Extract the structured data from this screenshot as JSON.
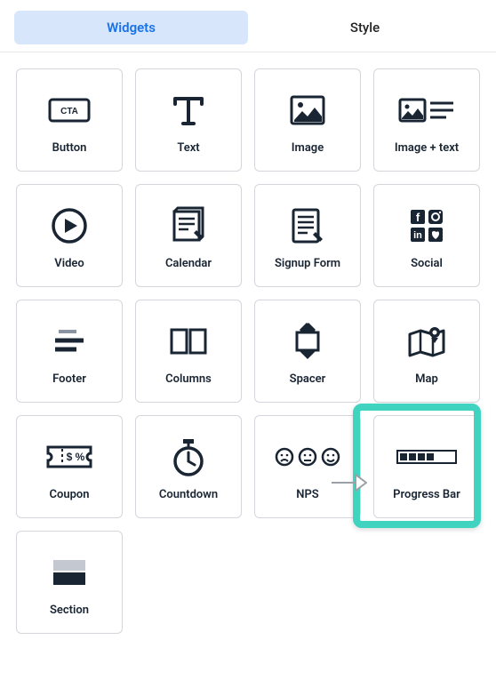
{
  "tabs": {
    "widgets": "Widgets",
    "style": "Style"
  },
  "widgets": [
    {
      "key": "button",
      "label": "Button"
    },
    {
      "key": "text",
      "label": "Text"
    },
    {
      "key": "image",
      "label": "Image"
    },
    {
      "key": "imagetext",
      "label": "Image + text"
    },
    {
      "key": "video",
      "label": "Video"
    },
    {
      "key": "calendar",
      "label": "Calendar"
    },
    {
      "key": "signup",
      "label": "Signup Form"
    },
    {
      "key": "social",
      "label": "Social"
    },
    {
      "key": "footer",
      "label": "Footer"
    },
    {
      "key": "columns",
      "label": "Columns"
    },
    {
      "key": "spacer",
      "label": "Spacer"
    },
    {
      "key": "map",
      "label": "Map"
    },
    {
      "key": "coupon",
      "label": "Coupon"
    },
    {
      "key": "countdown",
      "label": "Countdown"
    },
    {
      "key": "nps",
      "label": "NPS"
    },
    {
      "key": "progressbar",
      "label": "Progress Bar"
    },
    {
      "key": "section",
      "label": "Section"
    }
  ],
  "cta_text": "CTA",
  "highlighted": "progressbar"
}
